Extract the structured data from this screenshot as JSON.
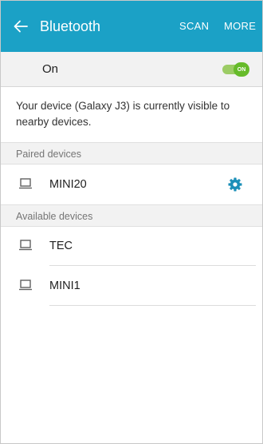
{
  "header": {
    "title": "Bluetooth",
    "back_icon": "arrow-left-icon",
    "actions": {
      "scan_label": "SCAN",
      "more_label": "MORE"
    },
    "color": "#1ba1c6"
  },
  "master_switch": {
    "label": "On",
    "toggle_text": "ON",
    "state": "on",
    "color": "#66bb2a"
  },
  "visibility_text": "Your device (Galaxy J3) is currently visible to nearby devices.",
  "paired": {
    "header": "Paired devices",
    "devices": [
      {
        "name": "MINI20",
        "icon": "laptop-icon",
        "settings_icon": "gear-icon"
      }
    ]
  },
  "available": {
    "header": "Available devices",
    "devices": [
      {
        "name": "TEC",
        "icon": "laptop-icon"
      },
      {
        "name": "MINI1",
        "icon": "laptop-icon"
      }
    ]
  }
}
